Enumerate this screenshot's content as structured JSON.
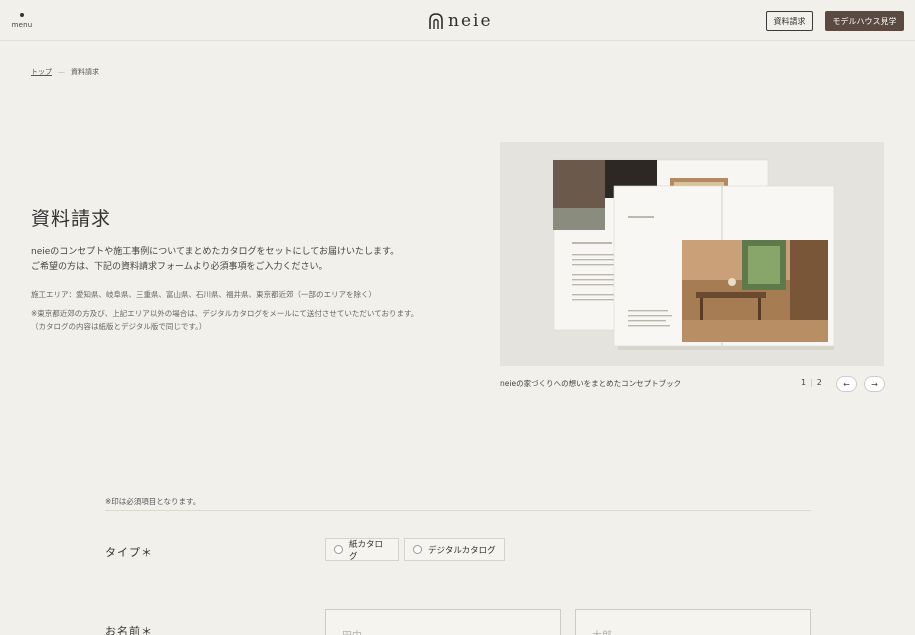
{
  "header": {
    "menu_label": "menu",
    "logo_text": "neie",
    "request_button": "資料請求",
    "modelhouse_button": "モデルハウス見学"
  },
  "breadcrumb": {
    "home": "トップ",
    "separator": "—",
    "current": "資料請求"
  },
  "intro": {
    "title": "資料請求",
    "lead_line1": "neieのコンセプトや施工事例についてまとめたカタログをセットにしてお届けいたします。",
    "lead_line2": "ご希望の方は、下記の資料請求フォームより必須事項をご入力ください。",
    "area": "施工エリア：愛知県、岐阜県、三重県、富山県、石川県、福井県、東京都近郊（一部のエリアを除く）",
    "note_line1": "※東京都近郊の方及び、上記エリア以外の場合は、デジタルカタログをメールにて送付させていただいております。",
    "note_line2": "（カタログの内容は紙版とデジタル版で同じです。）"
  },
  "catalog": {
    "caption": "neieの家づくりへの想いをまとめたコンセプトブック",
    "page_current": "1",
    "page_total": "2",
    "prev_arrow": "←",
    "next_arrow": "→"
  },
  "form": {
    "required_note": "※印は必須項目となります。",
    "type_label": "タイプ＊",
    "type_options": [
      "紙カタログ",
      "デジタルカタログ"
    ],
    "name_label": "お名前＊",
    "last_name_placeholder": "田中",
    "first_name_placeholder": "太郎"
  },
  "colors": {
    "background": "#f2f0ea",
    "accent_button": "#5a4a42"
  }
}
